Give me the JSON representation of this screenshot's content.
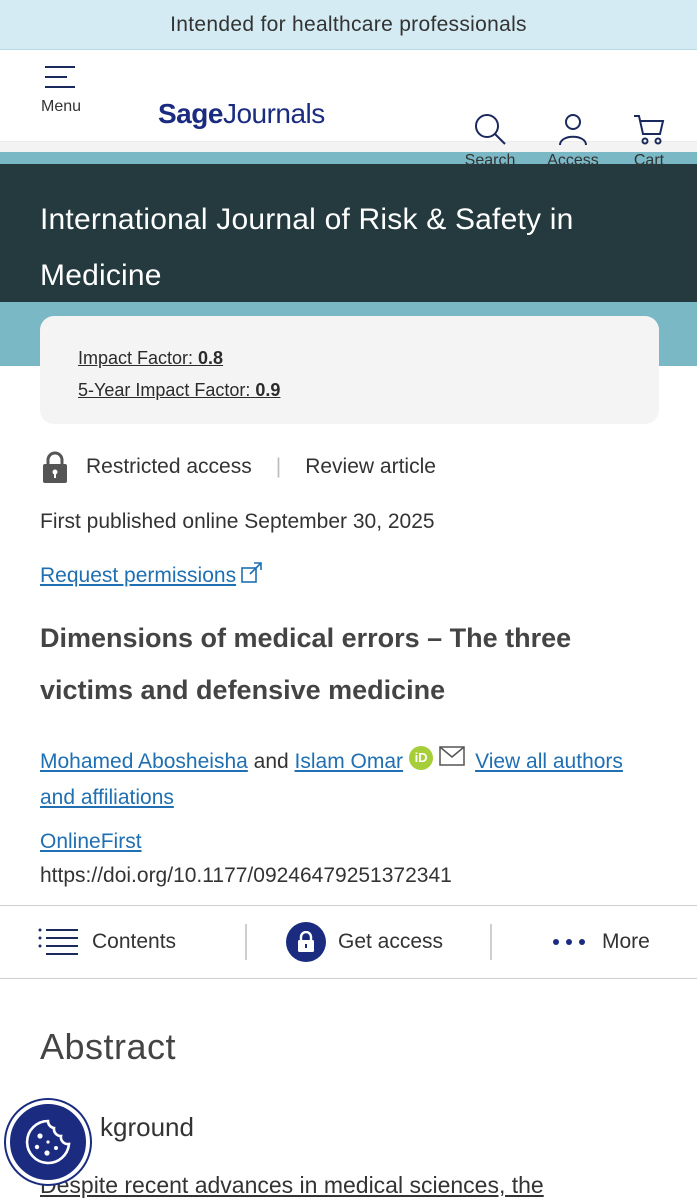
{
  "banner": {
    "text": "Intended for healthcare professionals"
  },
  "header": {
    "menu_label": "Menu",
    "logo_sage": "Sage",
    "logo_journals": "Journals",
    "search_label": "Search",
    "access_label": "Access",
    "cart_label": "Cart"
  },
  "journal": {
    "title": "International Journal of Risk & Safety in Medicine"
  },
  "metrics": {
    "impact_factor_label": "Impact Factor:",
    "impact_factor_value": "0.8",
    "five_year_label": "5-Year Impact Factor:",
    "five_year_value": "0.9"
  },
  "article": {
    "access_type": "Restricted access",
    "article_type": "Review article",
    "published": "First published online September 30, 2025",
    "request_permissions": "Request permissions",
    "title": "Dimensions of medical errors – The three victims and defensive medicine",
    "author1": "Mohamed Abosheisha",
    "and": "and",
    "author2": "Islam Omar",
    "view_all": "View all authors and affiliations",
    "orcid_text": "iD",
    "online_first": "OnlineFirst",
    "doi": "https://doi.org/10.1177/09246479251372341"
  },
  "toolbar": {
    "contents": "Contents",
    "get_access": "Get access",
    "more": "More"
  },
  "abstract": {
    "heading": "Abstract",
    "subheading": "kground",
    "first_line": "Despite recent advances in medical sciences, the"
  },
  "colors": {
    "brand": "#1a2b80",
    "link": "#1f6fb2",
    "band": "#243a3e",
    "teal": "#7ab8c6"
  }
}
